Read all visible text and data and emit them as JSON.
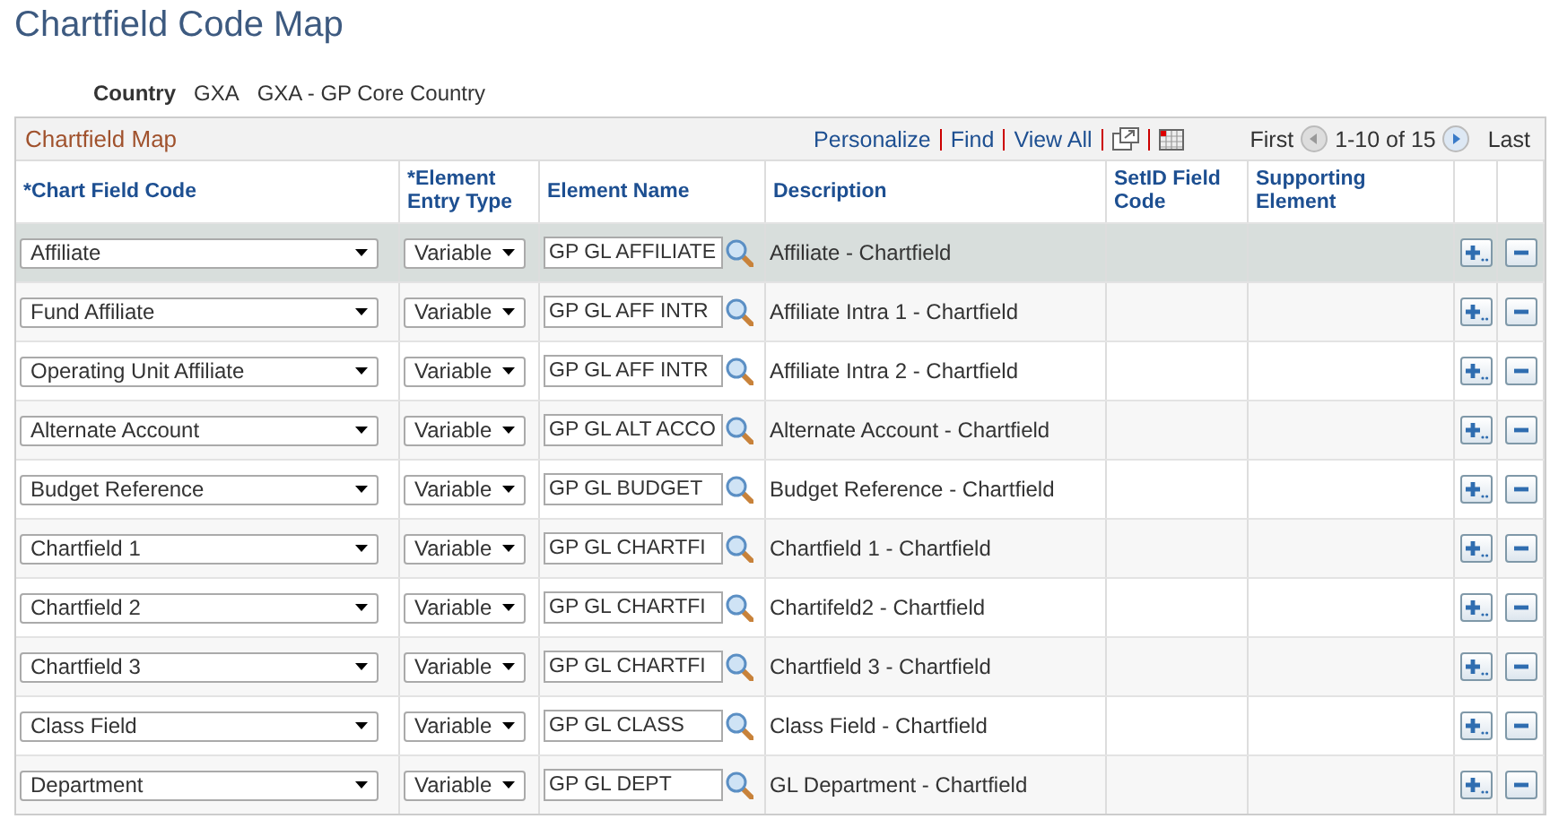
{
  "page_title": "Chartfield Code Map",
  "country": {
    "label": "Country",
    "code": "GXA",
    "description": "GXA - GP Core Country"
  },
  "grid": {
    "title": "Chartfield Map",
    "toolbar_links": [
      "Personalize",
      "Find",
      "View All"
    ],
    "nav": {
      "first": "First",
      "range": "1-10 of 15",
      "last": "Last"
    },
    "columns": [
      "*Chart Field Code",
      "*Element Entry Type",
      "Element Name",
      "Description",
      "SetID Field Code",
      "Supporting Element"
    ],
    "rows": [
      {
        "code": "Affiliate",
        "entry_type": "Variable",
        "element_name": "GP GL AFFILIATE",
        "description": "Affiliate - Chartfield",
        "selected": true
      },
      {
        "code": "Fund Affiliate",
        "entry_type": "Variable",
        "element_name": "GP GL AFF INTR",
        "description": "Affiliate Intra 1 - Chartfield",
        "selected": false
      },
      {
        "code": "Operating Unit Affiliate",
        "entry_type": "Variable",
        "element_name": "GP GL AFF INTR",
        "description": "Affiliate Intra 2 - Chartfield",
        "selected": false
      },
      {
        "code": "Alternate Account",
        "entry_type": "Variable",
        "element_name": "GP GL ALT ACCO",
        "description": "Alternate Account - Chartfield",
        "selected": false
      },
      {
        "code": "Budget Reference",
        "entry_type": "Variable",
        "element_name": "GP GL BUDGET",
        "description": "Budget Reference - Chartfield",
        "selected": false
      },
      {
        "code": "Chartfield 1",
        "entry_type": "Variable",
        "element_name": "GP GL CHARTFI",
        "description": "Chartfield 1 - Chartfield",
        "selected": false
      },
      {
        "code": "Chartfield 2",
        "entry_type": "Variable",
        "element_name": "GP GL CHARTFI",
        "description": "Chartifeld2 - Chartfield",
        "selected": false
      },
      {
        "code": "Chartfield 3",
        "entry_type": "Variable",
        "element_name": "GP GL CHARTFI",
        "description": "Chartfield 3 - Chartfield",
        "selected": false
      },
      {
        "code": "Class Field",
        "entry_type": "Variable",
        "element_name": "GP GL CLASS",
        "description": "Class Field - Chartfield",
        "selected": false
      },
      {
        "code": "Department",
        "entry_type": "Variable",
        "element_name": "GP GL DEPT",
        "description": "GL Department - Chartfield",
        "selected": false
      }
    ]
  }
}
